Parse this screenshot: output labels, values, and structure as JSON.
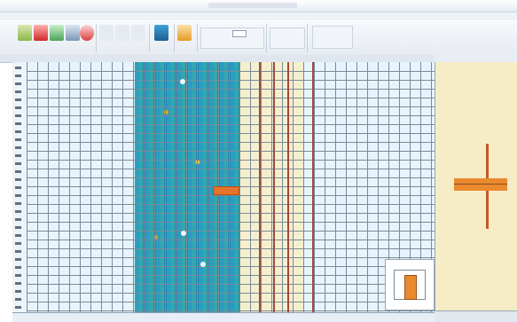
{
  "window": {
    "title": ""
  },
  "menubar": [],
  "ribbon": {
    "groups": [
      {
        "label": ""
      },
      {
        "label": ""
      },
      {
        "label": ""
      },
      {
        "label": ""
      },
      {
        "label": ""
      }
    ]
  },
  "chart_view": {
    "ruler_left_ticks": [],
    "ruler_bottom_ticks": []
  },
  "side_panel": {
    "header": ""
  },
  "colors": {
    "heat_blue": "#1f9ac0",
    "heat_teal": "#2aa5a5",
    "accent_orange": "#e4742b",
    "tan_band": "#f6efcf",
    "grid_line": "#7a8a98",
    "panel_bg": "#f6ecc6"
  },
  "icons": {
    "save": "check-icon",
    "delete": "close-icon",
    "refresh": "refresh-icon",
    "back": "undo-icon",
    "stop": "stop-icon",
    "palette": "palette-icon",
    "tools": "tools-icon"
  }
}
